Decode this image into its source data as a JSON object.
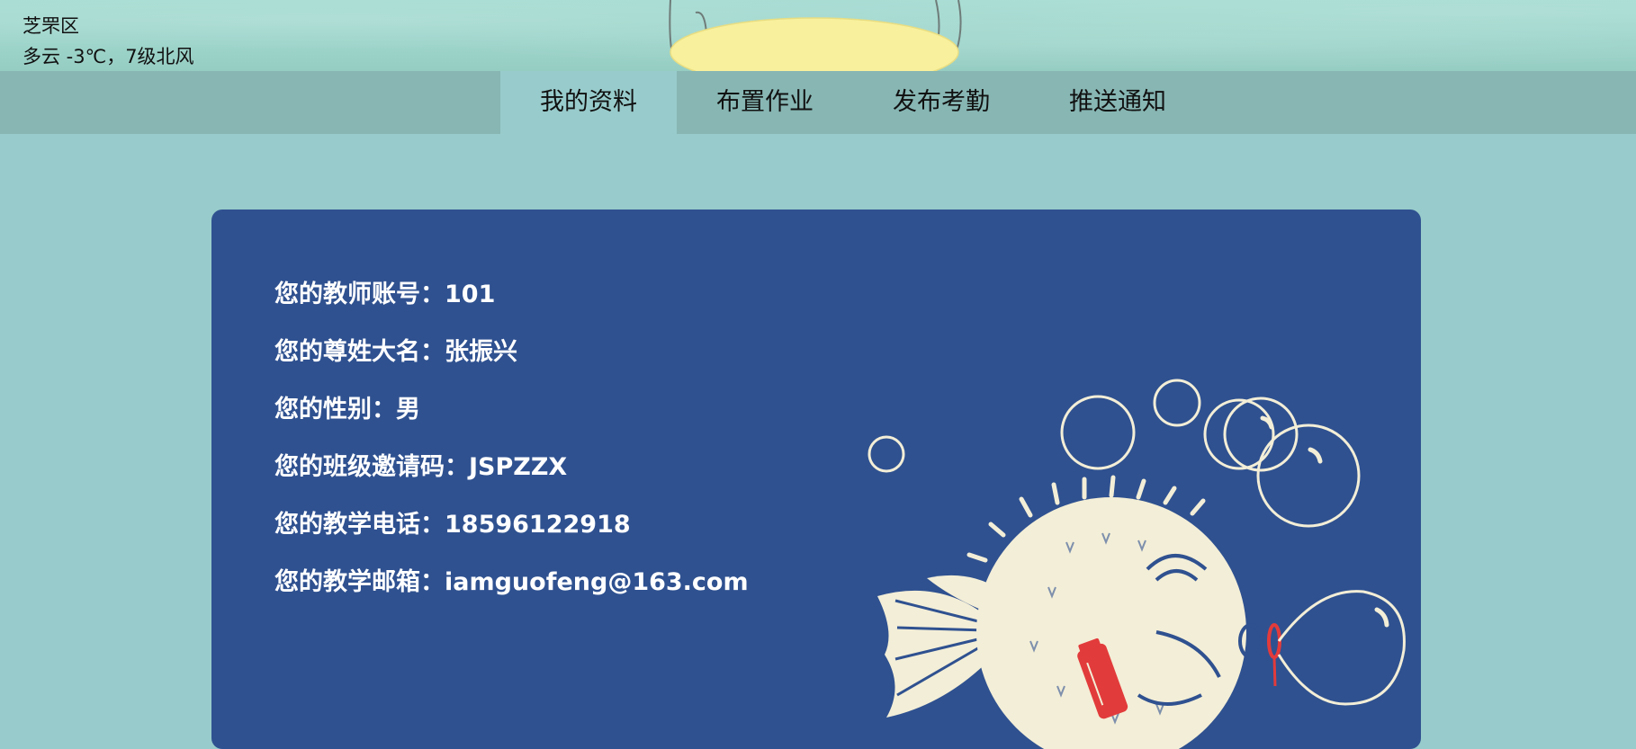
{
  "weather": {
    "district": "芝罘区",
    "condition": "多云 -3℃，7级北风"
  },
  "nav": {
    "items": [
      {
        "label": "我的资料",
        "active": true
      },
      {
        "label": "布置作业",
        "active": false
      },
      {
        "label": "发布考勤",
        "active": false
      },
      {
        "label": "推送通知",
        "active": false
      }
    ]
  },
  "profile": {
    "rows": [
      {
        "label": "您的教师账号",
        "value": "101"
      },
      {
        "label": "您的尊姓大名",
        "value": "张振兴"
      },
      {
        "label": "您的性别",
        "value": "男"
      },
      {
        "label": "您的班级邀请码",
        "value": "JSPZZX"
      },
      {
        "label": "您的教学电话",
        "value": "18596122918"
      },
      {
        "label": "您的教学邮箱",
        "value": "iamguofeng@163.com"
      }
    ],
    "separator": "："
  },
  "colors": {
    "page_background": "#98cbcb",
    "navbar_background": "#87b6b3",
    "card_background": "#2f5190",
    "illustration_cream": "#f3eed7",
    "bottle_red": "#e23b3b"
  },
  "illustration": {
    "icon": "pufferfish-blowing-bubbles-icon"
  }
}
